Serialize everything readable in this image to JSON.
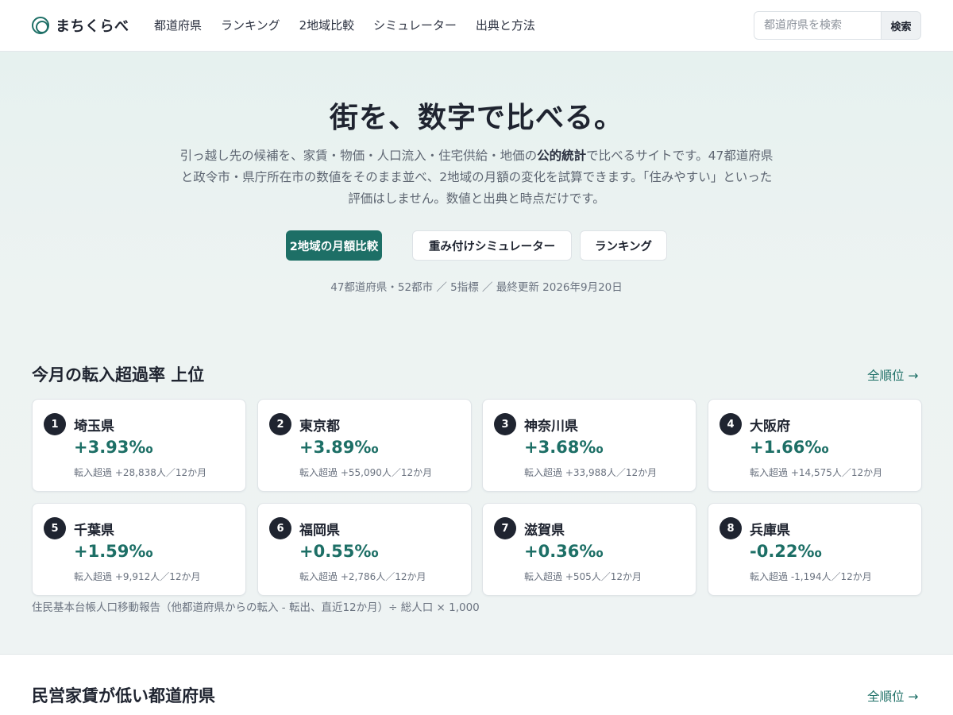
{
  "brand": {
    "name": "まちくらべ",
    "icon": "ring-logo-icon"
  },
  "nav": {
    "items": [
      {
        "label": "都道府県"
      },
      {
        "label": "ランキング"
      },
      {
        "label": "2地域比較"
      },
      {
        "label": "シミュレーター"
      },
      {
        "label": "出典と方法"
      }
    ]
  },
  "search": {
    "placeholder": "都道府県を検索",
    "button_label": "検索"
  },
  "hero": {
    "title": "街を、数字で比べる。",
    "desc_before": "引っ越し先の候補を、家賃・物価・人口流入・住宅供給・地価の",
    "desc_strong": "公的統計",
    "desc_after": "で比べるサイトです。47都道府県と政令市・県庁所在市の数値をそのまま並べ、2地域の月額の変化を試算できます。「住みやすい」といった評価はしません。数値と出典と時点だけです。",
    "cta_primary": "2地域の月額比較",
    "cta_simulator": "重み付けシミュレーター",
    "cta_ranking": "ランキング",
    "meta": "47都道府県・52都市 ／ 5指標 ／ 最終更新 2026年9月20日"
  },
  "migration": {
    "title": "今月の転入超過率 上位",
    "all_link": "全順位 →",
    "source": "住民基本台帳人口移動報告（他都道府県からの転入 - 転出、直近12か月）÷ 総人口 × 1,000",
    "rate_color_positive": "#1d6f66",
    "items": [
      {
        "rank": "1",
        "name": "埼玉県",
        "rate": "+3.93‰",
        "detail": "転入超過 +28,838人／12か月"
      },
      {
        "rank": "2",
        "name": "東京都",
        "rate": "+3.89‰",
        "detail": "転入超過 +55,090人／12か月"
      },
      {
        "rank": "3",
        "name": "神奈川県",
        "rate": "+3.68‰",
        "detail": "転入超過 +33,988人／12か月"
      },
      {
        "rank": "4",
        "name": "大阪府",
        "rate": "+1.66‰",
        "detail": "転入超過 +14,575人／12か月"
      },
      {
        "rank": "5",
        "name": "千葉県",
        "rate": "+1.59‰",
        "detail": "転入超過 +9,912人／12か月"
      },
      {
        "rank": "6",
        "name": "福岡県",
        "rate": "+0.55‰",
        "detail": "転入超過 +2,786人／12か月"
      },
      {
        "rank": "7",
        "name": "滋賀県",
        "rate": "+0.36‰",
        "detail": "転入超過 +505人／12か月"
      },
      {
        "rank": "8",
        "name": "兵庫県",
        "rate": "-0.22‰",
        "detail": "転入超過 -1,194人／12か月"
      }
    ]
  },
  "rent": {
    "title": "民営家賃が低い都道府県",
    "all_link": "全順位 →"
  }
}
